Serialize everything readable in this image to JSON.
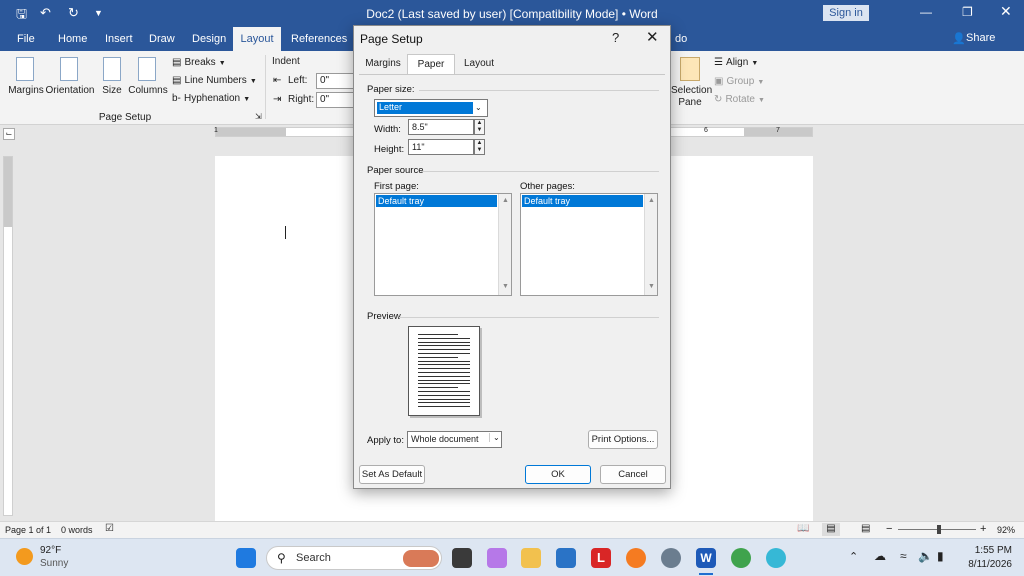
{
  "titlebar": {
    "title": "Doc2 (Last saved by user) [Compatibility Mode]  •  Word",
    "signin": "Sign in"
  },
  "tabs": [
    "File",
    "Home",
    "Insert",
    "Draw",
    "Design",
    "Layout",
    "References",
    "do"
  ],
  "active_tab": "Layout",
  "share": "Share",
  "ribbon": {
    "margins": "Margins",
    "orientation": "Orientation",
    "size": "Size",
    "columns": "Columns",
    "breaks": "Breaks",
    "line_numbers": "Line Numbers",
    "hyphenation": "Hyphenation",
    "group_page_setup": "Page Setup",
    "indent": "Indent",
    "left_label": "Left:",
    "left_value": "0\"",
    "right_label": "Right:",
    "right_value": "0\"",
    "selection_pane_1": "Selection",
    "selection_pane_2": "Pane",
    "align": "Align",
    "group": "Group",
    "rotate": "Rotate"
  },
  "ruler": {
    "numbers": [
      "1",
      "6",
      "7"
    ]
  },
  "dialog": {
    "title": "Page Setup",
    "help": "?",
    "tabs": [
      "Margins",
      "Paper",
      "Layout"
    ],
    "active_tab": "Paper",
    "paper_size_label": "Paper size:",
    "paper_size_value": "Letter",
    "width_label": "Width:",
    "width_value": "8.5\"",
    "height_label": "Height:",
    "height_value": "11\"",
    "paper_source_label": "Paper source",
    "first_page_label": "First page:",
    "other_pages_label": "Other pages:",
    "first_page_selected": "Default tray",
    "other_pages_selected": "Default tray",
    "preview_label": "Preview",
    "apply_to_label": "Apply to:",
    "apply_to_value": "Whole document",
    "print_options": "Print Options...",
    "set_default": "Set As Default",
    "ok": "OK",
    "cancel": "Cancel"
  },
  "statusbar": {
    "page": "Page 1 of 1",
    "words": "0 words",
    "zoom": "92%",
    "zoom_fraction": 0.52
  },
  "taskbar": {
    "temperature": "92°F",
    "weather": "Sunny",
    "search": "Search",
    "time": "1:55 PM",
    "date": "8/11/2026"
  }
}
